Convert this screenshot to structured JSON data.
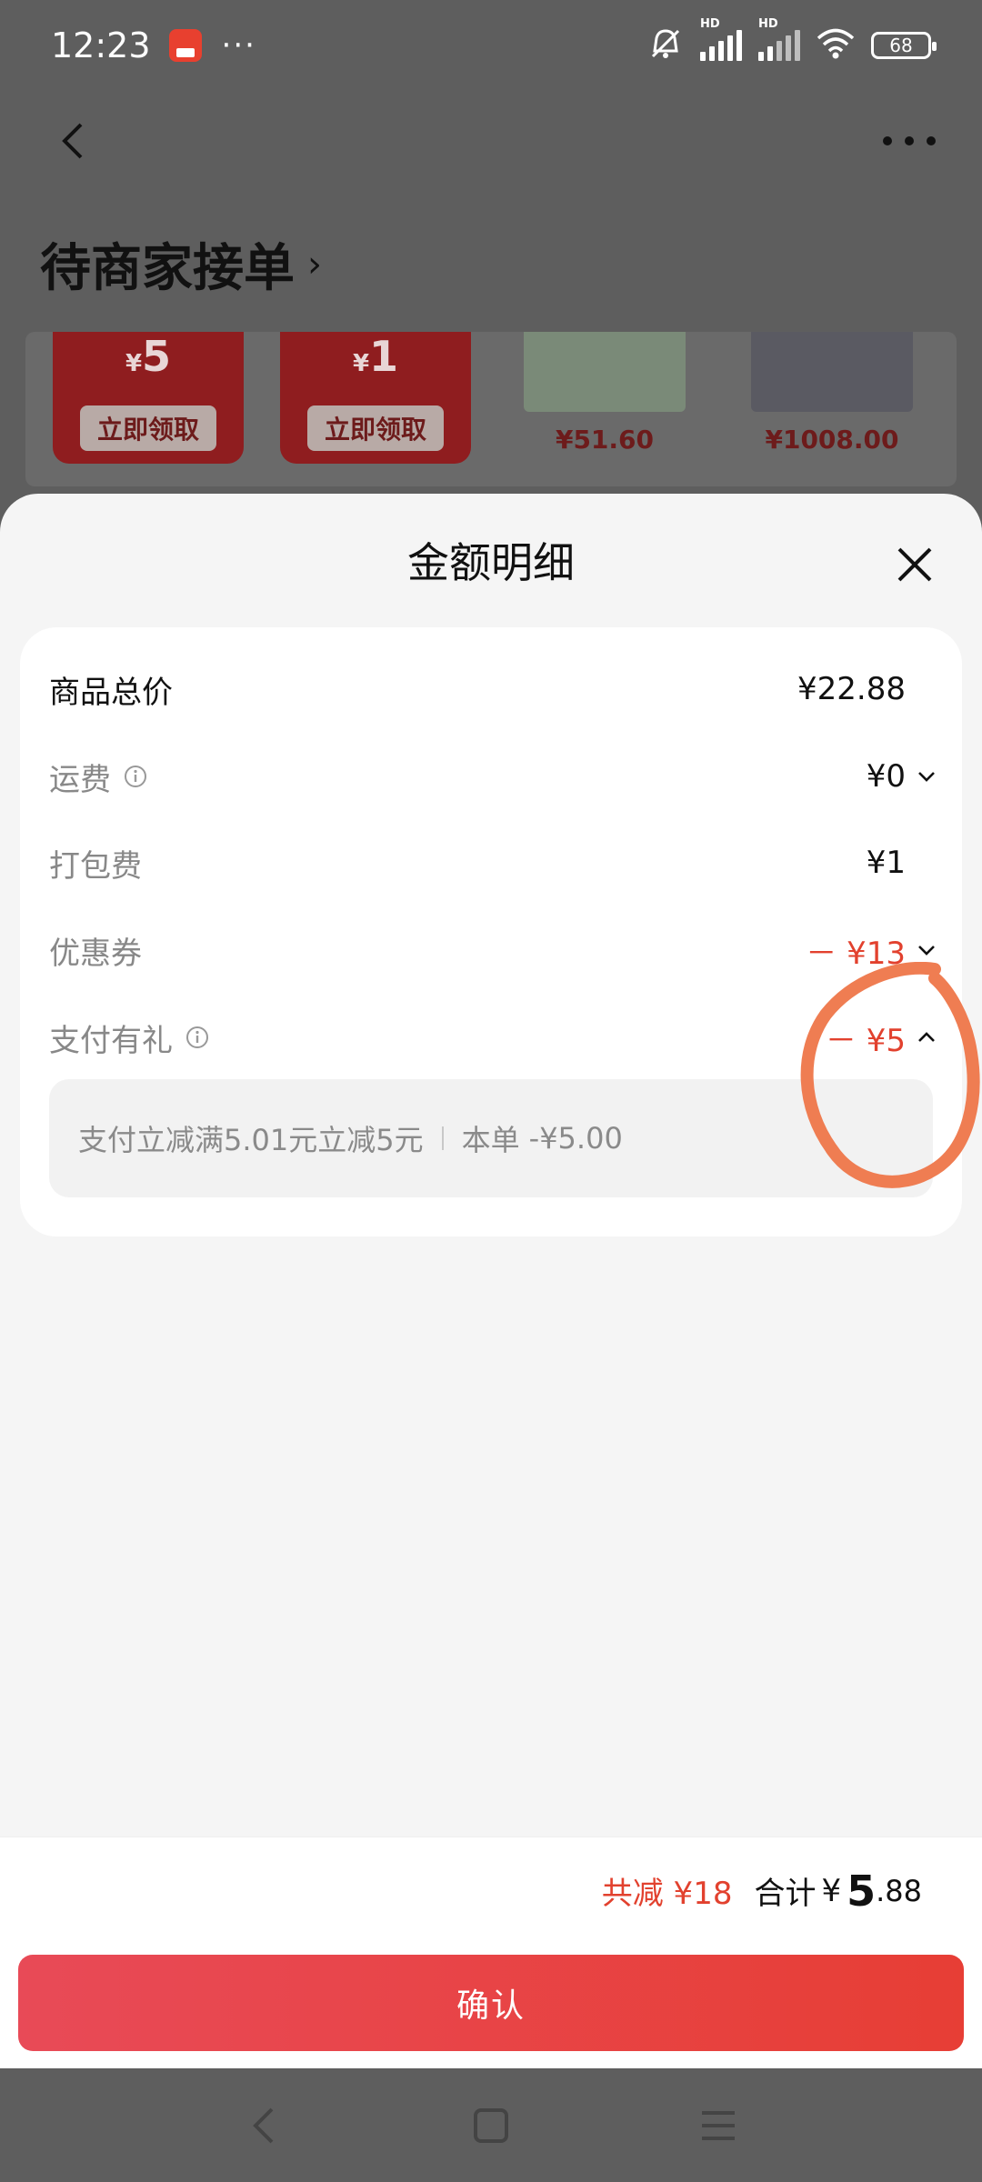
{
  "status_bar": {
    "time": "12:23",
    "app_icon": "alipay-app-icon",
    "more": "···",
    "network_label": "HD",
    "battery": "68"
  },
  "page": {
    "order_status": "待商家接单",
    "order_status_chevron": "›",
    "promo": {
      "currency": "¥",
      "coupons": [
        {
          "amount": "5",
          "action": "立即领取"
        },
        {
          "amount": "1",
          "action": "立即领取"
        }
      ],
      "products": [
        {
          "price": "¥51.60"
        },
        {
          "price": "¥1008.00"
        }
      ]
    }
  },
  "sheet": {
    "title": "金额明细",
    "rows": {
      "goods_total": {
        "label": "商品总价",
        "value": "¥22.88"
      },
      "shipping": {
        "label": "运费",
        "value": "¥0"
      },
      "packing": {
        "label": "打包费",
        "value": "¥1"
      },
      "coupon": {
        "label": "优惠券",
        "value": "－ ¥13"
      },
      "pay_gift": {
        "label": "支付有礼",
        "value": "－ ¥5"
      }
    },
    "pay_gift_detail": {
      "text": "支付立减满5.01元立减5元",
      "order_label": "本单",
      "amount": "-¥5.00"
    }
  },
  "footer": {
    "saved": "共减 ¥18",
    "total_label": "合计",
    "total_currency": "¥",
    "total_int": "5",
    "total_dec": ".88",
    "confirm": "确认"
  },
  "colors": {
    "accent_red": "#e2412e",
    "annotation": "#ef7d52",
    "confirm_gradient_start": "#e84a57",
    "confirm_gradient_end": "#e73e35"
  }
}
